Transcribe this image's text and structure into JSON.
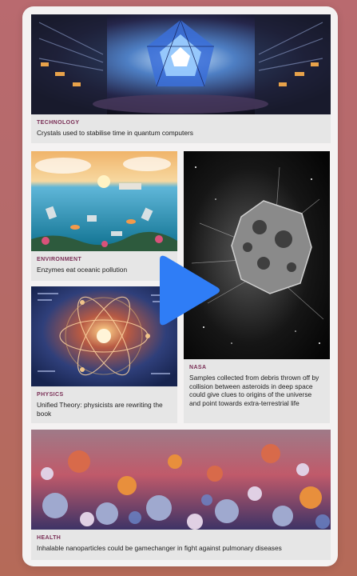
{
  "articles": [
    {
      "category": "TECHNOLOGY",
      "headline": "Crystals used to stabilise time in quantum computers",
      "image": "quantum-crystal-image"
    },
    {
      "category": "ENVIRONMENT",
      "headline": "Enzymes eat oceanic pollution",
      "image": "ocean-pollution-image"
    },
    {
      "category": "NASA",
      "headline": "Samples collected from debris thrown off by collision between asteroids in deep space could give clues to origins of the universe and point towards extra-terrestrial life",
      "image": "asteroid-image"
    },
    {
      "category": "PHYSICS",
      "headline": "Unified Theory: physicists are rewriting the book",
      "image": "atom-formulas-image"
    },
    {
      "category": "HEALTH",
      "headline": "Inhalable nanoparticles could be gamechanger in fight against pulmonary diseases",
      "image": "nanoparticles-image"
    }
  ],
  "overlay": {
    "icon": "play-icon",
    "color": "#2f7df6"
  }
}
